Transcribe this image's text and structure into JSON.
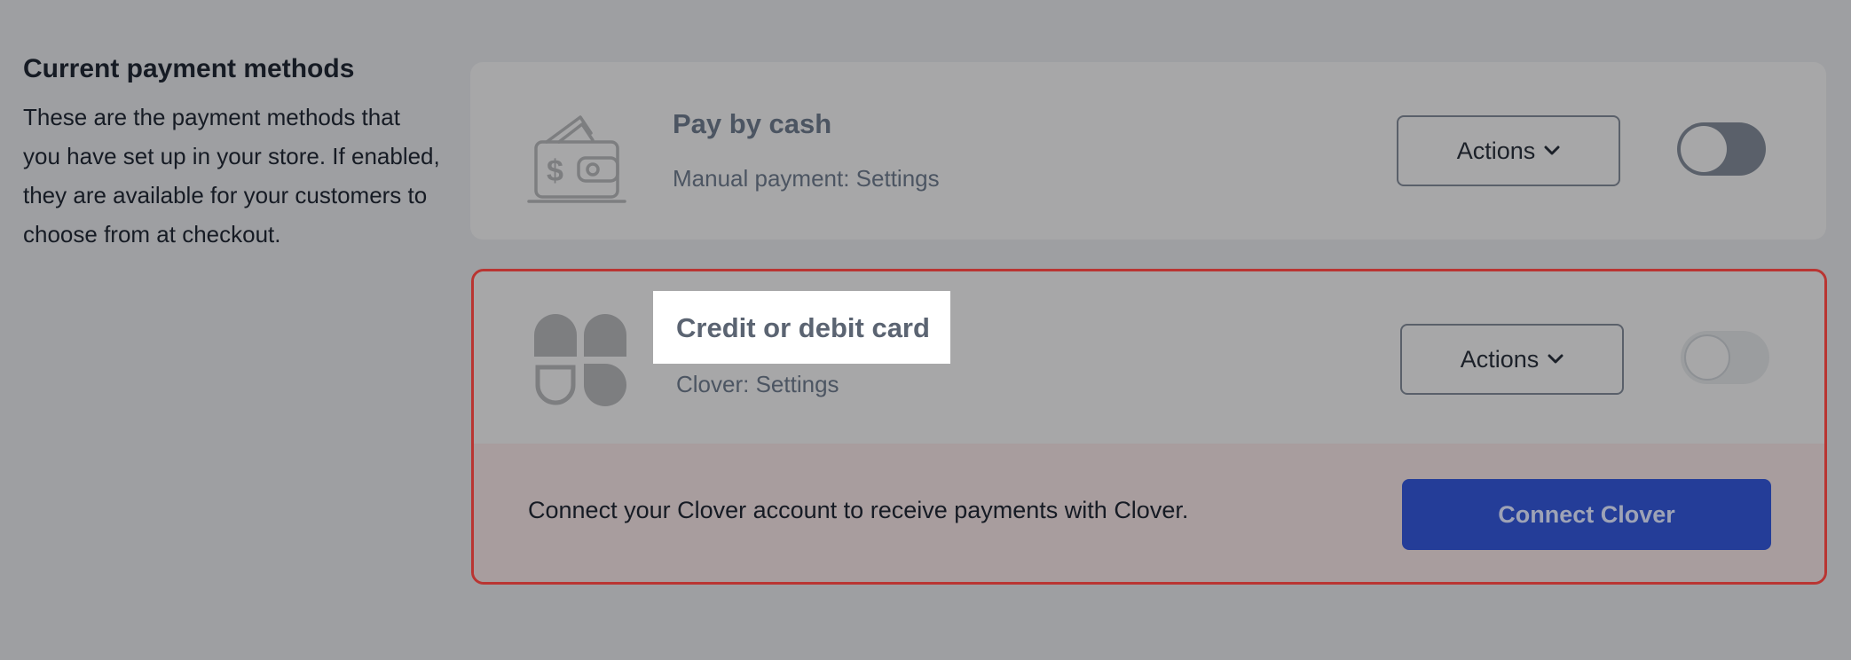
{
  "section": {
    "title": "Current payment methods",
    "description": "These are the payment methods that you have set up in your store. If enabled, they are available for your customers to choose from at checkout."
  },
  "methods": [
    {
      "title": "Pay by cash",
      "subtitle": "Manual payment: Settings",
      "icon": "wallet-cash-icon",
      "actions_label": "Actions",
      "enabled": true
    },
    {
      "title": "Credit or debit card",
      "subtitle": "Clover: Settings",
      "icon": "clover-logo-icon",
      "actions_label": "Actions",
      "enabled": false,
      "connect_text": "Connect your Clover account to receive payments with Clover.",
      "connect_button": "Connect Clover"
    }
  ],
  "colors": {
    "overlay": "#9e9fa2",
    "error_border": "#b93532",
    "primary_button": "#243d98",
    "highlight": "#ffffff"
  }
}
